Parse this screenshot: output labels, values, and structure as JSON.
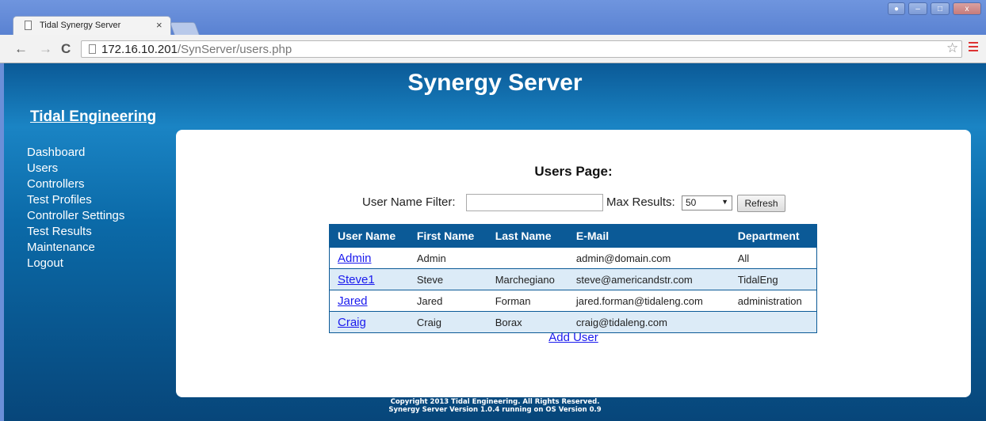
{
  "browser": {
    "tab_title": "Tidal Synergy Server",
    "tab_close": "×",
    "url_host": "172.16.10.201",
    "url_path": "/SynServer/users.php",
    "icons": [
      "page-icon",
      "back-arrow-icon",
      "forward-arrow-icon",
      "reload-icon",
      "star-icon",
      "menu-icon",
      "user-icon",
      "minimize-icon",
      "maximize-icon",
      "close-icon"
    ]
  },
  "site": {
    "title": "Synergy Server",
    "company": "Tidal Engineering"
  },
  "sidebar": {
    "items": [
      {
        "label": "Dashboard"
      },
      {
        "label": "Users"
      },
      {
        "label": "Controllers"
      },
      {
        "label": "Test Profiles"
      },
      {
        "label": "Controller Settings"
      },
      {
        "label": "Test Results"
      },
      {
        "label": "Maintenance"
      },
      {
        "label": "Logout"
      }
    ]
  },
  "main": {
    "heading": "Users Page:",
    "filter_label": "User Name Filter:",
    "filter_value": "",
    "max_label": "Max Results:",
    "max_value": "50",
    "refresh_label": "Refresh",
    "table": {
      "headers": [
        "User Name",
        "First Name",
        "Last Name",
        "E-Mail",
        "Department"
      ],
      "rows": [
        [
          "Admin",
          "Admin",
          "",
          "admin@domain.com",
          "All"
        ],
        [
          "Steve1",
          "Steve",
          "Marchegiano",
          "steve@americandstr.com",
          "TidalEng"
        ],
        [
          "Jared",
          "Jared",
          "Forman",
          "jared.forman@tidaleng.com",
          "administration"
        ],
        [
          "Craig",
          "Craig",
          "Borax",
          "craig@tidaleng.com",
          ""
        ]
      ]
    },
    "add_user": "Add User"
  },
  "footer": {
    "line1": "Copyright 2013 Tidal Engineering. All Rights Reserved.",
    "line2": "Synergy Server Version 1.0.4 running on OS Version 0.9"
  },
  "colors": {
    "header_blue": "#0b5a97",
    "row_alt": "#dcebf7",
    "link": "#1a1aee"
  }
}
